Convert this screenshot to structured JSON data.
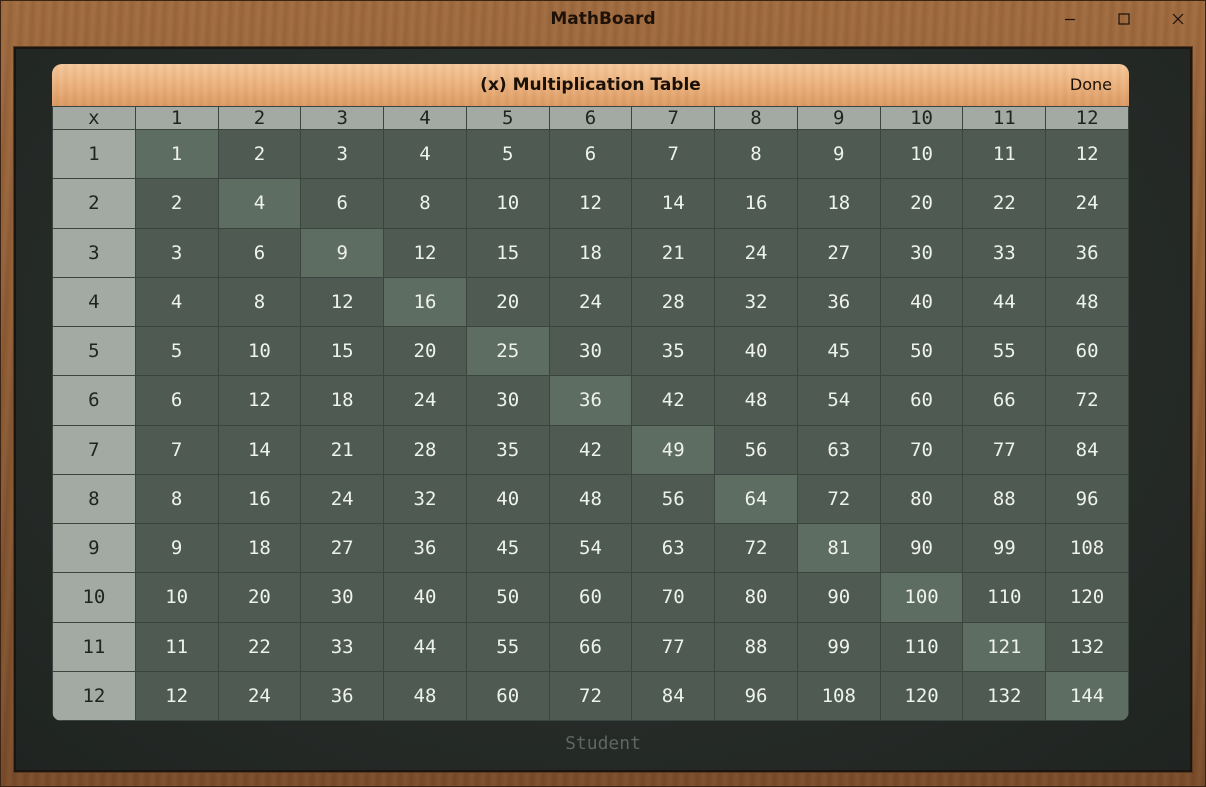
{
  "window": {
    "title": "MathBoard",
    "controls": {
      "minimize_icon": "minimize-icon",
      "maximize_icon": "maximize-icon",
      "close_icon": "close-icon"
    }
  },
  "panel": {
    "title": "(x) Multiplication Table",
    "done_label": "Done"
  },
  "table": {
    "corner": "x",
    "columns": [
      "1",
      "2",
      "3",
      "4",
      "5",
      "6",
      "7",
      "8",
      "9",
      "10",
      "11",
      "12"
    ],
    "rows": [
      {
        "label": "1",
        "cells": [
          "1",
          "2",
          "3",
          "4",
          "5",
          "6",
          "7",
          "8",
          "9",
          "10",
          "11",
          "12"
        ]
      },
      {
        "label": "2",
        "cells": [
          "2",
          "4",
          "6",
          "8",
          "10",
          "12",
          "14",
          "16",
          "18",
          "20",
          "22",
          "24"
        ]
      },
      {
        "label": "3",
        "cells": [
          "3",
          "6",
          "9",
          "12",
          "15",
          "18",
          "21",
          "24",
          "27",
          "30",
          "33",
          "36"
        ]
      },
      {
        "label": "4",
        "cells": [
          "4",
          "8",
          "12",
          "16",
          "20",
          "24",
          "28",
          "32",
          "36",
          "40",
          "44",
          "48"
        ]
      },
      {
        "label": "5",
        "cells": [
          "5",
          "10",
          "15",
          "20",
          "25",
          "30",
          "35",
          "40",
          "45",
          "50",
          "55",
          "60"
        ]
      },
      {
        "label": "6",
        "cells": [
          "6",
          "12",
          "18",
          "24",
          "30",
          "36",
          "42",
          "48",
          "54",
          "60",
          "66",
          "72"
        ]
      },
      {
        "label": "7",
        "cells": [
          "7",
          "14",
          "21",
          "28",
          "35",
          "42",
          "49",
          "56",
          "63",
          "70",
          "77",
          "84"
        ]
      },
      {
        "label": "8",
        "cells": [
          "8",
          "16",
          "24",
          "32",
          "40",
          "48",
          "56",
          "64",
          "72",
          "80",
          "88",
          "96"
        ]
      },
      {
        "label": "9",
        "cells": [
          "9",
          "18",
          "27",
          "36",
          "45",
          "54",
          "63",
          "72",
          "81",
          "90",
          "99",
          "108"
        ]
      },
      {
        "label": "10",
        "cells": [
          "10",
          "20",
          "30",
          "40",
          "50",
          "60",
          "70",
          "80",
          "90",
          "100",
          "110",
          "120"
        ]
      },
      {
        "label": "11",
        "cells": [
          "11",
          "22",
          "33",
          "44",
          "55",
          "66",
          "77",
          "88",
          "99",
          "110",
          "121",
          "132"
        ]
      },
      {
        "label": "12",
        "cells": [
          "12",
          "24",
          "36",
          "48",
          "60",
          "72",
          "84",
          "96",
          "108",
          "120",
          "132",
          "144"
        ]
      }
    ]
  },
  "footer": {
    "user_label": "Student"
  },
  "colors": {
    "header_cell": "#a3aaa4",
    "body_cell": "#4f5b52",
    "diagonal_cell": "#5e6d61",
    "panel_header": "#eeb47f",
    "board": "#262b28",
    "frame_wood": "#8b5a33"
  }
}
